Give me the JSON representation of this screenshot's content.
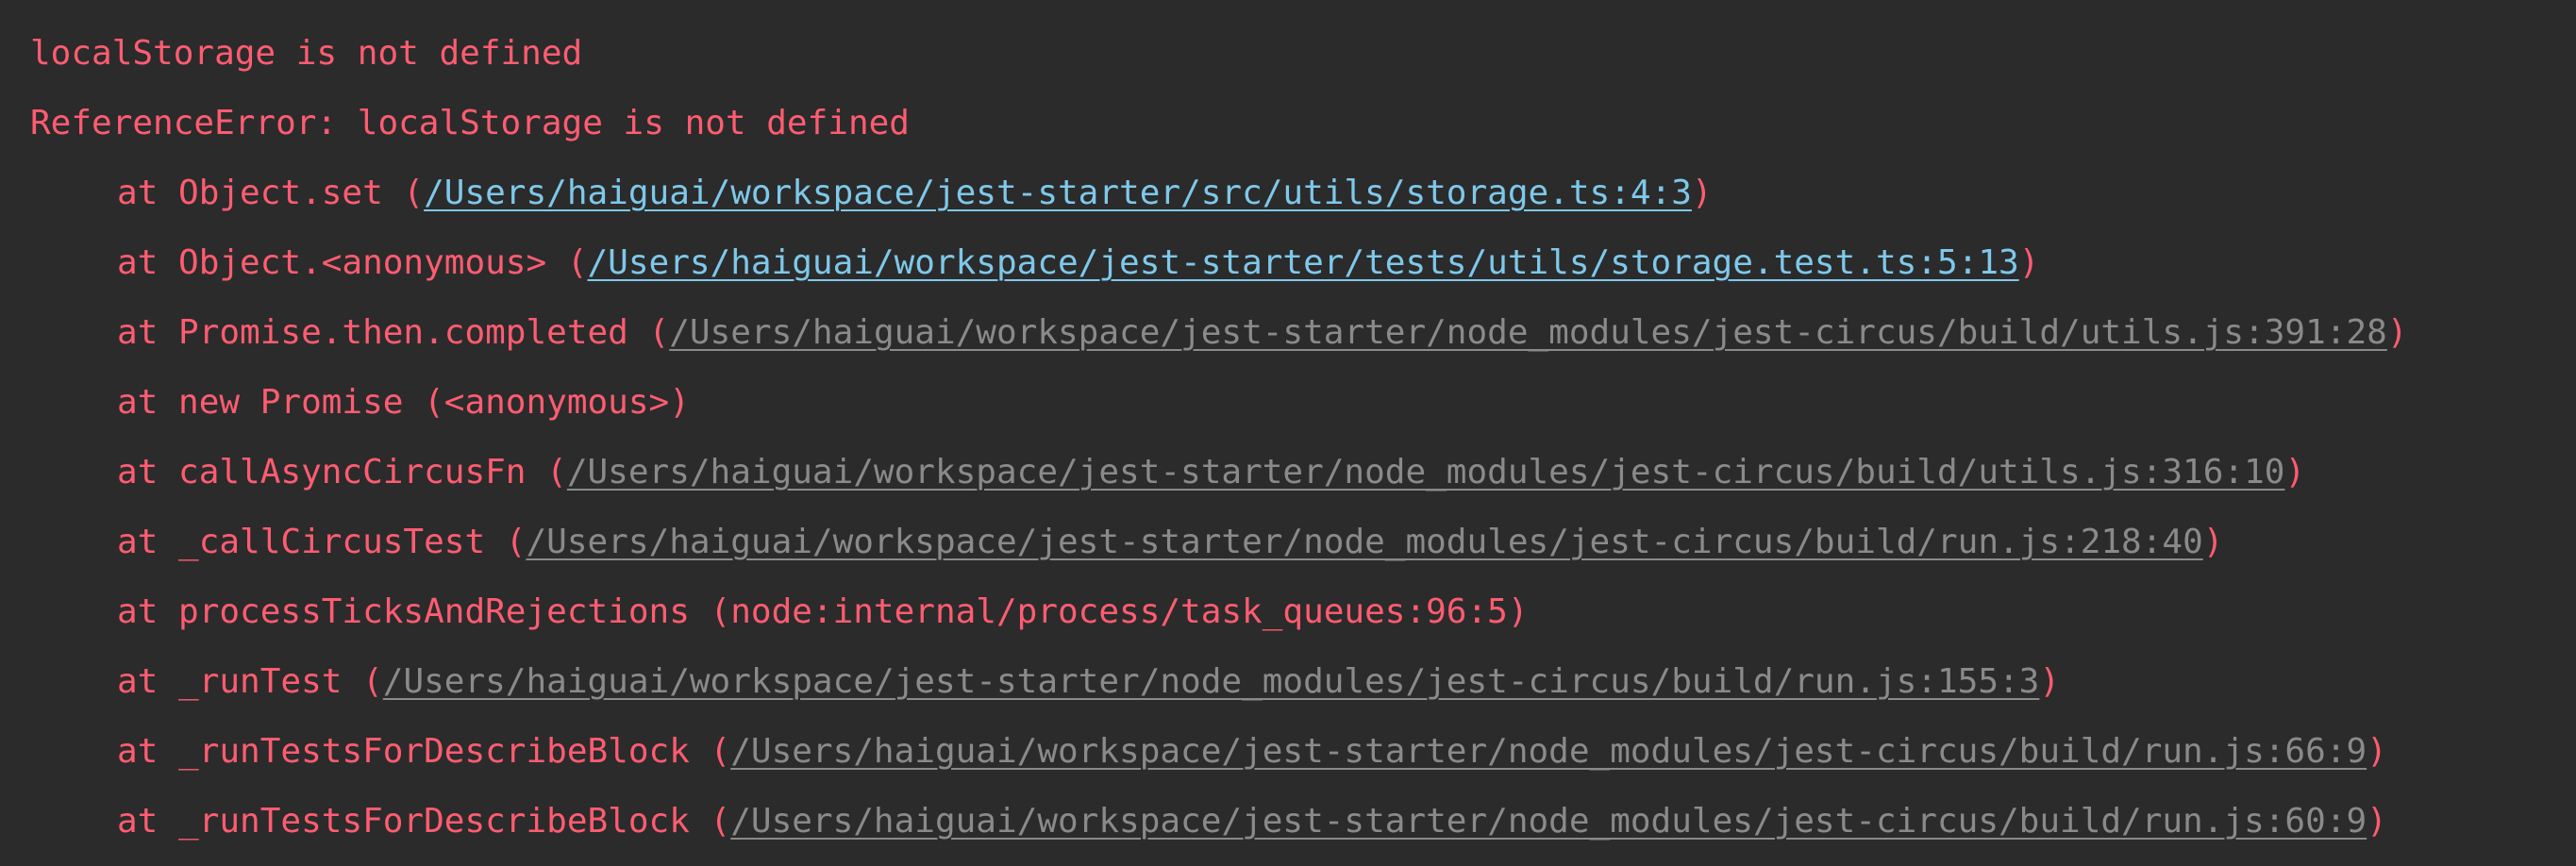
{
  "console": {
    "error_message": "localStorage is not defined",
    "error_header": "ReferenceError: localStorage is not defined",
    "frames": [
      {
        "prefix": "at Object.set (",
        "location": "/Users/haiguai/workspace/jest-starter/src/utils/storage.ts:4:3",
        "suffix": ")",
        "kind": "project"
      },
      {
        "prefix": "at Object.<anonymous> (",
        "location": "/Users/haiguai/workspace/jest-starter/tests/utils/storage.test.ts:5:13",
        "suffix": ")",
        "kind": "project"
      },
      {
        "prefix": "at Promise.then.completed (",
        "location": "/Users/haiguai/workspace/jest-starter/node_modules/jest-circus/build/utils.js:391:28",
        "suffix": ")",
        "kind": "library"
      },
      {
        "prefix": "at new Promise (<anonymous>)",
        "location": "",
        "suffix": "",
        "kind": "plain"
      },
      {
        "prefix": "at callAsyncCircusFn (",
        "location": "/Users/haiguai/workspace/jest-starter/node_modules/jest-circus/build/utils.js:316:10",
        "suffix": ")",
        "kind": "library"
      },
      {
        "prefix": "at _callCircusTest (",
        "location": "/Users/haiguai/workspace/jest-starter/node_modules/jest-circus/build/run.js:218:40",
        "suffix": ")",
        "kind": "library"
      },
      {
        "prefix": "at processTicksAndRejections (node:internal/process/task_queues:96:5)",
        "location": "",
        "suffix": "",
        "kind": "plain"
      },
      {
        "prefix": "at _runTest (",
        "location": "/Users/haiguai/workspace/jest-starter/node_modules/jest-circus/build/run.js:155:3",
        "suffix": ")",
        "kind": "library"
      },
      {
        "prefix": "at _runTestsForDescribeBlock (",
        "location": "/Users/haiguai/workspace/jest-starter/node_modules/jest-circus/build/run.js:66:9",
        "suffix": ")",
        "kind": "library"
      },
      {
        "prefix": "at _runTestsForDescribeBlock (",
        "location": "/Users/haiguai/workspace/jest-starter/node_modules/jest-circus/build/run.js:60:9",
        "suffix": ")",
        "kind": "library"
      }
    ]
  },
  "colors": {
    "background": "#2b2b2b",
    "error_text": "#ff5c71",
    "project_link": "#7ec8ea",
    "library_link": "#8a8a8a"
  }
}
